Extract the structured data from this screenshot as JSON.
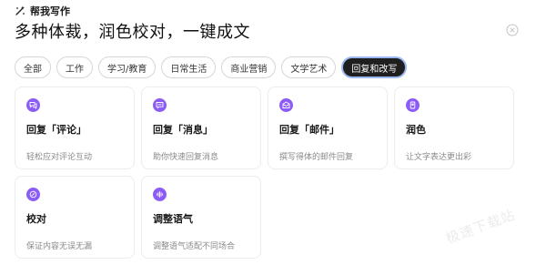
{
  "header": {
    "title": "帮我写作",
    "icon": "magic-wand-icon"
  },
  "headline": "多种体裁，润色校对，一键成文",
  "tabs": [
    {
      "label": "全部",
      "active": false
    },
    {
      "label": "工作",
      "active": false
    },
    {
      "label": "学习/教育",
      "active": false
    },
    {
      "label": "日常生活",
      "active": false
    },
    {
      "label": "商业营销",
      "active": false
    },
    {
      "label": "文学艺术",
      "active": false
    },
    {
      "label": "回复和改写",
      "active": true
    }
  ],
  "cards": [
    {
      "title": "回复「评论」",
      "desc": "轻松应对评论互动",
      "icon": "comment-icon"
    },
    {
      "title": "回复「消息」",
      "desc": "助你快速回复消息",
      "icon": "message-icon"
    },
    {
      "title": "回复「邮件」",
      "desc": "撰写得体的邮件回复",
      "icon": "mail-icon"
    },
    {
      "title": "润色",
      "desc": "让文字表达更出彩",
      "icon": "polish-icon"
    },
    {
      "title": "校对",
      "desc": "保证内容无误无漏",
      "icon": "proofread-icon"
    },
    {
      "title": "调整语气",
      "desc": "调整语气适配不同场合",
      "icon": "tone-icon"
    }
  ],
  "watermark": "极速下载站",
  "colors": {
    "accent": "#8b5cf6",
    "active_tab_bg": "#1f1f1f",
    "active_tab_border": "#9cb8f2"
  }
}
